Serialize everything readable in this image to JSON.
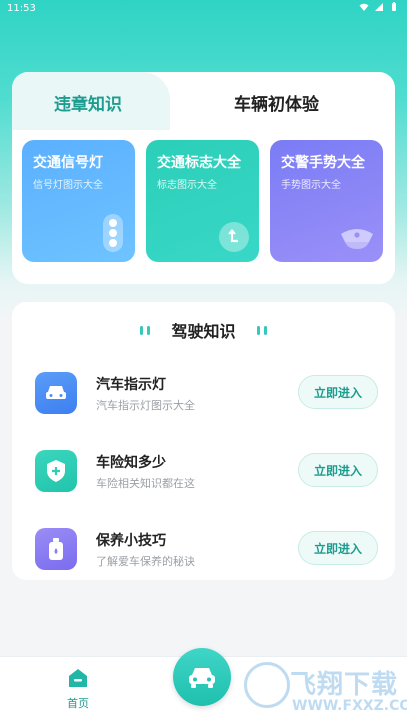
{
  "status": {
    "time": "11:53"
  },
  "tabs": [
    {
      "label": "违章知识",
      "active": true
    },
    {
      "label": "车辆初体验",
      "active": false
    }
  ],
  "tiles": [
    {
      "title": "交通信号灯",
      "subtitle": "信号灯图示大全",
      "icon": "traffic-light-icon"
    },
    {
      "title": "交通标志大全",
      "subtitle": "标志图示大全",
      "icon": "turn-sign-icon"
    },
    {
      "title": "交警手势大全",
      "subtitle": "手势图示大全",
      "icon": "police-cap-icon"
    }
  ],
  "knowledge": {
    "title": "驾驶知识",
    "items": [
      {
        "title": "汽车指示灯",
        "subtitle": "汽车指示灯图示大全",
        "button": "立即进入",
        "icon": "car-icon",
        "color": "#4c8ef5"
      },
      {
        "title": "车险知多少",
        "subtitle": "车险相关知识都在这",
        "button": "立即进入",
        "icon": "shield-plus-icon",
        "color": "#2fcfb4"
      },
      {
        "title": "保养小技巧",
        "subtitle": "了解爱车保养的秘诀",
        "button": "立即进入",
        "icon": "oil-bottle-icon",
        "color": "#8a7cf2"
      }
    ]
  },
  "nav": {
    "home_label": "首页"
  },
  "watermark": {
    "text": "飞翔下载",
    "url": "WWW.FXXZ.COM"
  },
  "colors": {
    "accent": "#1e9c8f",
    "header_gradient": "#2fd4c4"
  }
}
